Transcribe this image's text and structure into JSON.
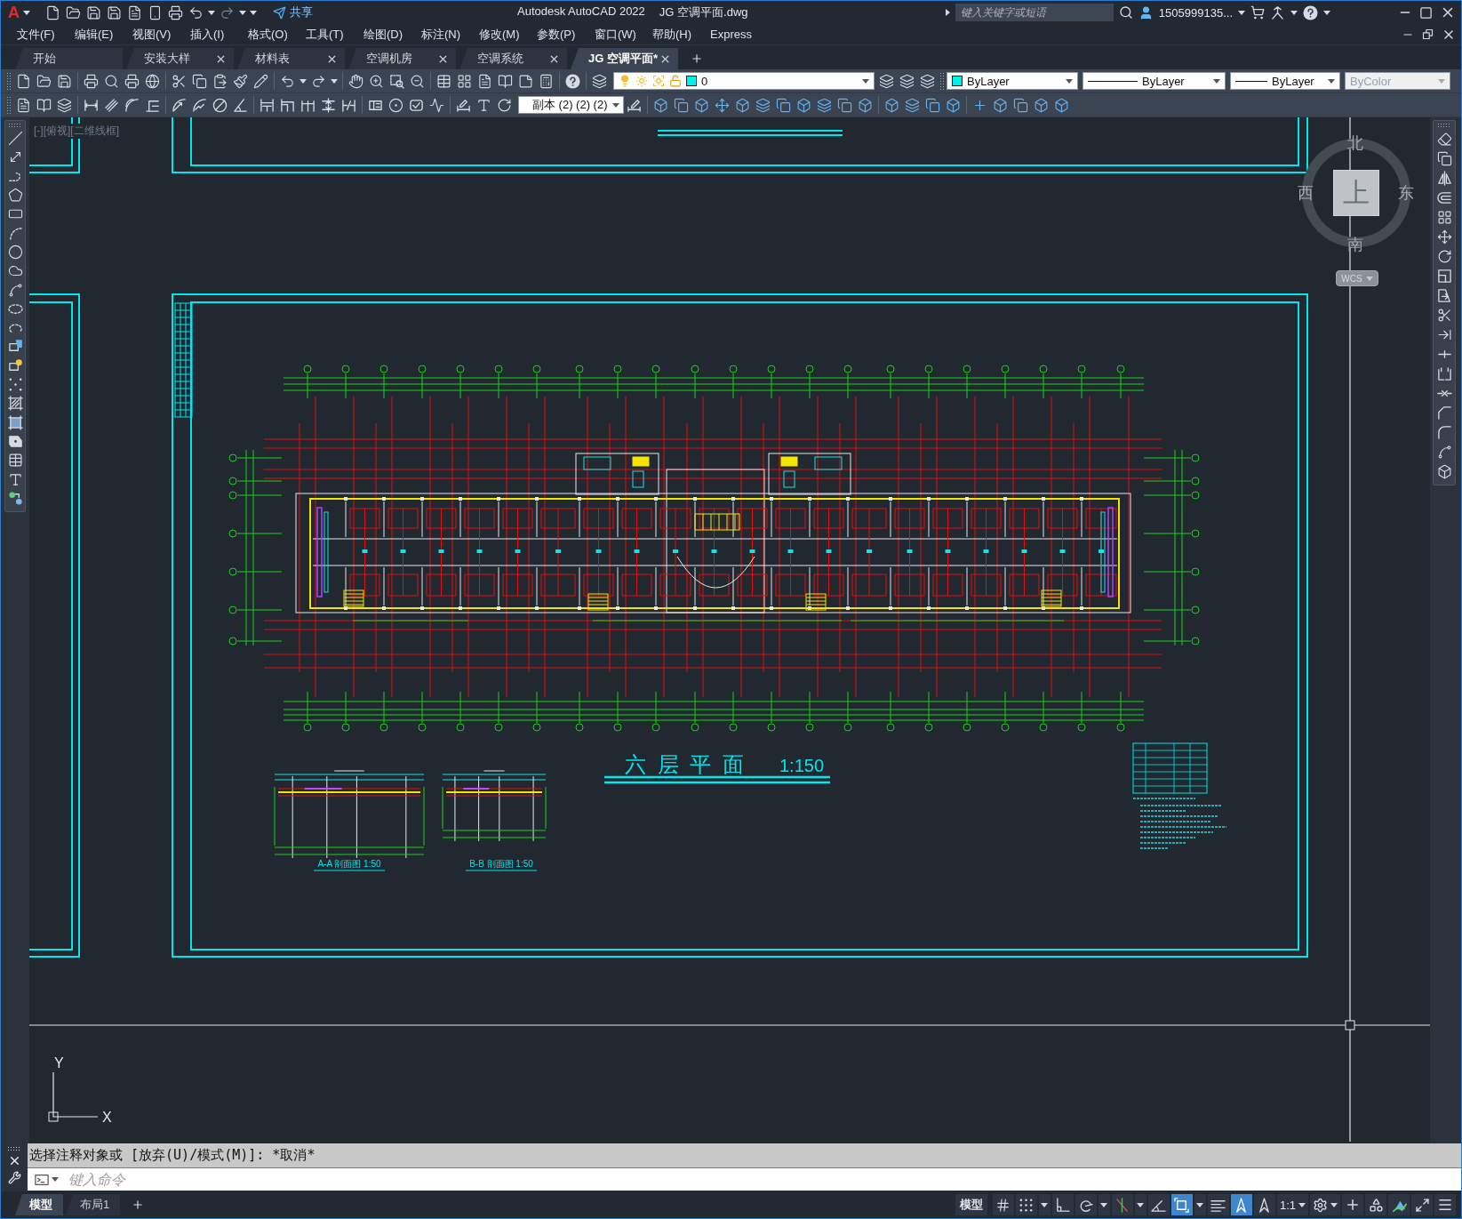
{
  "title_bar": {
    "logo": "A",
    "share_label": "共享",
    "app_title": "Autodesk AutoCAD 2022",
    "file_name": "JG 空调平面.dwg",
    "search": {
      "placeholder": "键入关键字或短语"
    },
    "user_name": "1505999135..."
  },
  "menu_bar": [
    "文件(F)",
    "编辑(E)",
    "视图(V)",
    "插入(I)",
    "格式(O)",
    "工具(T)",
    "绘图(D)",
    "标注(N)",
    "修改(M)",
    "参数(P)",
    "窗口(W)",
    "帮助(H)",
    "Express"
  ],
  "file_tabs": [
    {
      "label": "开始",
      "selected": false,
      "closable": false
    },
    {
      "label": "安装大样",
      "selected": false,
      "closable": true
    },
    {
      "label": "材料表",
      "selected": false,
      "closable": true
    },
    {
      "label": "空调机房",
      "selected": false,
      "closable": true
    },
    {
      "label": "空调系统",
      "selected": false,
      "closable": true
    },
    {
      "label": "JG 空调平面*",
      "selected": true,
      "closable": true
    }
  ],
  "properties_toolbar": {
    "layer": "0",
    "dropdowns": [
      {
        "kind": "color",
        "value": "ByLayer",
        "disabled": false
      },
      {
        "kind": "linetype",
        "value": "ByLayer",
        "disabled": false
      },
      {
        "kind": "lineweight",
        "value": "ByLayer",
        "disabled": false
      },
      {
        "kind": "plotstyle",
        "value": "ByColor",
        "disabled": true
      }
    ]
  },
  "dimension_toolbar": {
    "dimension_style": "副本 (2) (2) (2)"
  },
  "viewport": {
    "controls_label": "[-][俯视][二维线框]",
    "view_cube": {
      "face": "上",
      "north": "北",
      "south": "南",
      "west": "西",
      "east": "东",
      "coordinate_system": "WCS"
    },
    "ucs_icon": {
      "y_label": "Y",
      "x_label": "X"
    }
  },
  "drawing": {
    "title": "六 层 平 面",
    "scale": "1:150",
    "sections": [
      {
        "label": "A-A 剖面图 1:50"
      },
      {
        "label": "B-B 剖面图 1:50"
      }
    ]
  },
  "command_line": {
    "history": "选择注释对象或 [放弃(U)/模式(M)]: *取消*",
    "placeholder": "键入命令"
  },
  "layout_tabs": [
    {
      "label": "模型",
      "selected": true
    },
    {
      "label": "布局1",
      "selected": false
    }
  ],
  "status_bar": {
    "space": "模型",
    "toggles": [
      {
        "on": false
      },
      {
        "on": false
      },
      {
        "on": false
      },
      {
        "on": false
      },
      {
        "on": false
      },
      {
        "on": false
      },
      {
        "on": true
      },
      {
        "on": false
      },
      {
        "on": true
      },
      {
        "on": false
      }
    ],
    "annotation_scale": "1:1"
  }
}
